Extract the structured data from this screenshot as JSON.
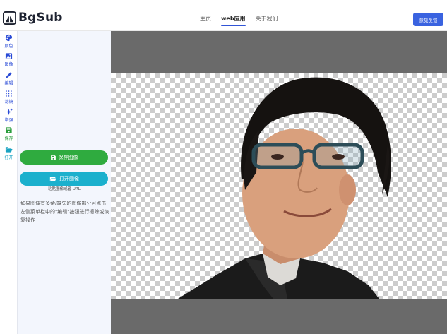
{
  "header": {
    "logo_text": "BgSub",
    "nav": [
      "主页",
      "web应用",
      "关于我们"
    ],
    "active_nav": "web应用",
    "feedback_label": "意见反馈",
    "accent_color": "#3a63e0"
  },
  "rail": {
    "items": [
      {
        "label": "颜色",
        "icon": "palette-icon"
      },
      {
        "label": "图像",
        "icon": "image-icon"
      },
      {
        "label": "编辑",
        "icon": "pencil-icon"
      },
      {
        "label": "滤镜",
        "icon": "grid-icon"
      },
      {
        "label": "增强",
        "icon": "sparkle-icon"
      },
      {
        "label": "保存",
        "icon": "save-icon"
      },
      {
        "label": "打开",
        "icon": "folder-open-icon"
      }
    ]
  },
  "panel": {
    "save_button": "保存图像",
    "open_button": "打开图像",
    "paste_hint_prefix": "粘贴图像或者",
    "paste_hint_link": "URL",
    "tip": "如果图像有多余/缺失的图像部分可点击左侧菜单栏中的\"编辑\"按钮进行擦除或恢复操作",
    "save_color": "#2fab3f",
    "open_color": "#1bb0cd"
  },
  "canvas": {
    "background": "#6a6a6a",
    "content": "background-removed portrait on transparent checkerboard"
  }
}
